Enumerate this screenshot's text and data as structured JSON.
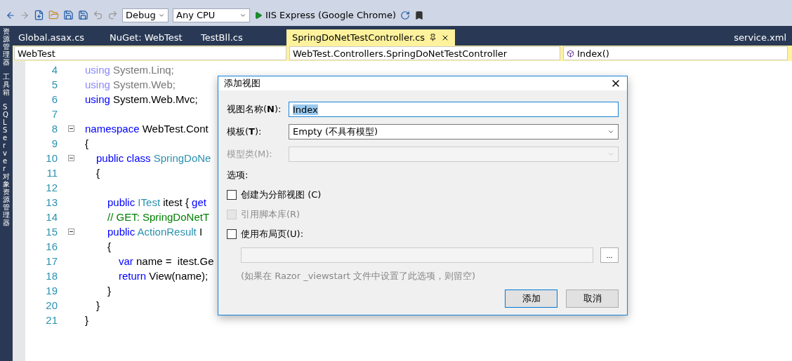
{
  "toolbar": {
    "config": "Debug",
    "platform": "Any CPU",
    "run": "IIS Express (Google Chrome)"
  },
  "side_panels": [
    "资源管理器",
    "工具箱",
    "SQL Server 对象资源管理器"
  ],
  "tabs": [
    {
      "label": "Global.asax.cs",
      "selected": false
    },
    {
      "label": "NuGet: WebTest",
      "selected": false
    },
    {
      "label": "TestBll.cs",
      "selected": false
    },
    {
      "label": "SpringDoNetTestController.cs",
      "selected": true
    }
  ],
  "right_tab": "service.xml",
  "nav": {
    "project": "WebTest",
    "type": "WebTest.Controllers.SpringDoNetTestController",
    "member": "Index()"
  },
  "code_lines": [
    {
      "num": "4",
      "fold": false,
      "tokens": [
        {
          "text": "using",
          "kind": "faded_keyword"
        },
        {
          "text": " System.Linq;",
          "kind": "faded"
        }
      ]
    },
    {
      "num": "5",
      "fold": false,
      "tokens": [
        {
          "text": "using",
          "kind": "faded_keyword"
        },
        {
          "text": " System.Web;",
          "kind": "faded"
        }
      ]
    },
    {
      "num": "6",
      "fold": false,
      "tokens": [
        {
          "text": "using",
          "kind": "keyword"
        },
        {
          "text": " System.Web.Mvc;",
          "kind": "plain"
        }
      ]
    },
    {
      "num": "7",
      "fold": false
    },
    {
      "num": "8",
      "fold": true,
      "tokens": [
        {
          "text": "namespace",
          "kind": "keyword"
        },
        {
          "text": " WebTest.Cont",
          "kind": "plain"
        }
      ]
    },
    {
      "num": "9",
      "fold": false,
      "tokens": [
        {
          "text": "{",
          "kind": "plain"
        }
      ],
      "children": [
        {
          "num": "10",
          "fold": true,
          "tokens": [
            {
              "text": "public class",
              "kind": "keyword"
            },
            {
              "text": " SpringDoNe",
              "kind": "type"
            }
          ]
        },
        {
          "num": "11",
          "fold": false,
          "tokens": [
            {
              "text": "{",
              "kind": "plain"
            }
          ],
          "children": [
            {
              "num": "12",
              "fold": false
            },
            {
              "num": "13",
              "fold": false,
              "tokens": [
                {
                  "text": "public",
                  "kind": "keyword"
                },
                {
                  "text": " ITest",
                  "kind": "type"
                },
                {
                  "text": " itest { ",
                  "kind": "plain"
                },
                {
                  "text": "get",
                  "kind": "keyword"
                }
              ]
            },
            {
              "num": "14",
              "fold": false,
              "tokens": [
                {
                  "text": "// GET: SpringDoNetT",
                  "kind": "comment"
                }
              ]
            },
            {
              "num": "15",
              "fold": true,
              "tokens": [
                {
                  "text": "public",
                  "kind": "keyword"
                },
                {
                  "text": " ActionResult",
                  "kind": "type"
                },
                {
                  "text": " I",
                  "kind": "plain"
                }
              ]
            },
            {
              "num": "16",
              "fold": false,
              "tokens": [
                {
                  "text": "{",
                  "kind": "plain"
                }
              ],
              "children": [
                {
                  "num": "17",
                  "fold": false,
                  "tokens": [
                    {
                      "text": "var",
                      "kind": "keyword"
                    },
                    {
                      "text": " name =  itest.Ge",
                      "kind": "plain"
                    }
                  ]
                },
                {
                  "num": "18",
                  "fold": false,
                  "tokens": [
                    {
                      "text": "return",
                      "kind": "keyword"
                    },
                    {
                      "text": " View(name);",
                      "kind": "plain"
                    }
                  ]
                }
              ]
            },
            {
              "num": "19",
              "fold": false,
              "tokens": [
                {
                  "text": "}",
                  "kind": "plain"
                }
              ]
            }
          ]
        },
        {
          "num": "20",
          "fold": false,
          "tokens": [
            {
              "text": "}",
              "kind": "plain"
            }
          ]
        }
      ]
    },
    {
      "num": "21",
      "fold": false,
      "tokens": [
        {
          "text": "}",
          "kind": "plain"
        }
      ]
    }
  ],
  "dialog": {
    "title": "添加视图",
    "name_label": "视图名称(**N**):",
    "name_value": "Index",
    "template_label": "模板(**T**):",
    "template_value": "Empty (不具有模型)",
    "model_label": "模型类(M):",
    "model_disabled": true,
    "options_label": "选项:",
    "options": [
      {
        "label": "创建为分部视图 (C)",
        "checked": false,
        "disabled": false
      },
      {
        "label": "引用脚本库(R)",
        "checked": false,
        "disabled": true
      },
      {
        "label": "使用布局页(U):",
        "checked": false,
        "disabled": false
      }
    ],
    "browse": "...",
    "hint": "(如果在 Razor _viewstart 文件中设置了此选项，则留空)",
    "buttons": [
      {
        "label": "添加",
        "default": true
      },
      {
        "label": "取消",
        "default": false
      }
    ]
  }
}
